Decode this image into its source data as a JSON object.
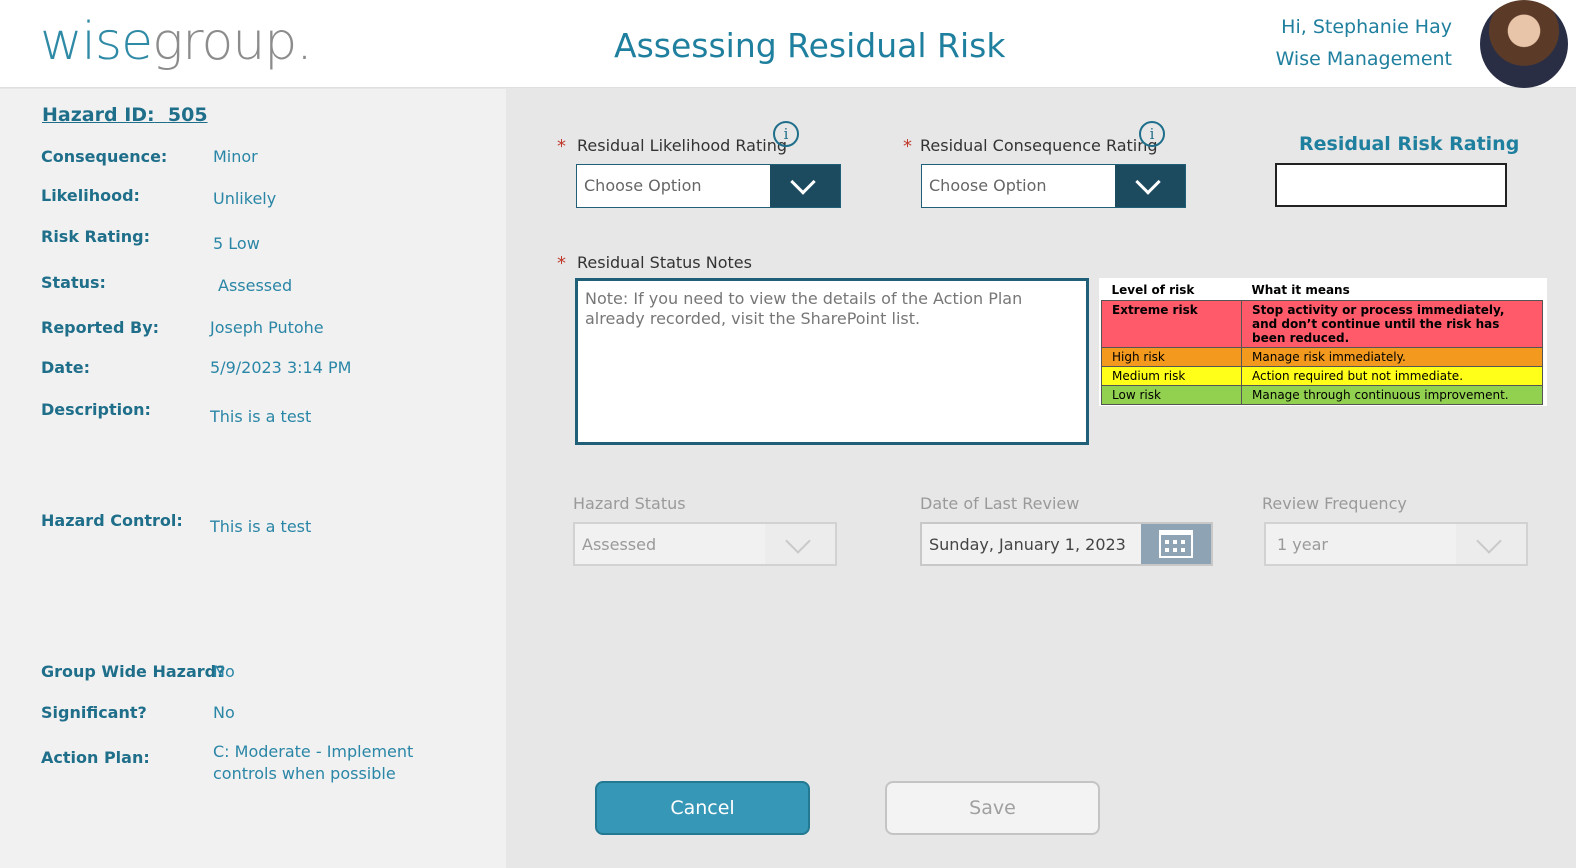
{
  "header": {
    "logo_part1": "wise",
    "logo_part2": "group.",
    "title": "Assessing Residual Risk",
    "greeting": "Hi, Stephanie Hay",
    "organization": "Wise Management"
  },
  "hazard": {
    "id_label": "Hazard ID:",
    "id_value": "505",
    "fields": {
      "consequence": {
        "label": "Consequence:",
        "value": "Minor"
      },
      "likelihood": {
        "label": "Likelihood:",
        "value": "Unlikely"
      },
      "risk_rating": {
        "label": "Risk Rating:",
        "value": "5 Low"
      },
      "status": {
        "label": "Status:",
        "value": "Assessed"
      },
      "reported_by": {
        "label": "Reported By:",
        "value": "Joseph Putohe"
      },
      "date": {
        "label": "Date:",
        "value": "5/9/2023 3:14 PM"
      },
      "description": {
        "label": "Description:",
        "value": "This is a test"
      },
      "hazard_control": {
        "label": "Hazard Control:",
        "value": "This is a test"
      },
      "group_wide": {
        "label": "Group Wide Hazard?",
        "value": "No"
      },
      "significant": {
        "label": "Significant?",
        "value": "No"
      },
      "action_plan": {
        "label": "Action Plan:",
        "value": "C: Moderate - Implement controls when possible"
      }
    }
  },
  "form": {
    "required_mark": "*",
    "likelihood": {
      "label": "Residual Likelihood Rating",
      "value": "Choose Option"
    },
    "consequence": {
      "label": "Residual Consequence Rating",
      "value": "Choose Option"
    },
    "risk_rating": {
      "label": "Residual Risk Rating",
      "value": ""
    },
    "notes": {
      "label": "Residual Status Notes",
      "placeholder": "Note: If you need to view the details of the Action Plan already recorded, visit the SharePoint list."
    },
    "hazard_status": {
      "label": "Hazard Status",
      "value": "Assessed"
    },
    "last_review": {
      "label": "Date of Last Review",
      "value": "Sunday, January 1, 2023"
    },
    "review_frequency": {
      "label": "Review Frequency",
      "value": "1 year"
    },
    "cancel_label": "Cancel",
    "save_label": "Save",
    "info_glyph": "i"
  },
  "legend": {
    "headers": [
      "Level of risk",
      "What it means"
    ],
    "rows": [
      {
        "level": "Extreme risk",
        "meaning": "Stop activity or process immediately, and don’t continue until the risk has been reduced.",
        "color": "#ff5a6a"
      },
      {
        "level": "High risk",
        "meaning": "Manage risk immediately.",
        "color": "#f39a1e"
      },
      {
        "level": "Medium risk",
        "meaning": "Action required but not immediate.",
        "color": "#ffff1a"
      },
      {
        "level": "Low risk",
        "meaning": "Manage through continuous improvement.",
        "color": "#92d050"
      }
    ]
  }
}
